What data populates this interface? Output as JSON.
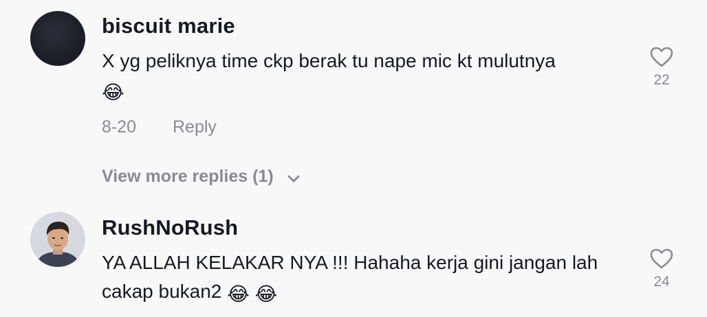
{
  "comments": [
    {
      "username": "biscuit marie",
      "text": "X yg peliknya time ckp berak tu nape mic kt mulutnya",
      "emoji": "😂",
      "date": "8-20",
      "reply_label": "Reply",
      "like_count": "22",
      "avatar_icon": "dark-avatar"
    },
    {
      "username": "RushNoRush",
      "text": "YA ALLAH KELAKAR NYA !!! Hahaha kerja gini jangan lah cakap bukan2",
      "emoji": "😂 😂",
      "like_count": "24",
      "avatar_icon": "photo-avatar"
    }
  ],
  "view_more_replies": "View more replies (1)",
  "icons": {
    "like": "heart-outline-icon",
    "expand": "chevron-down-icon"
  },
  "colors": {
    "background": "#f8f8f8",
    "primary_text": "#161823",
    "secondary_text": "#8a8b91"
  }
}
